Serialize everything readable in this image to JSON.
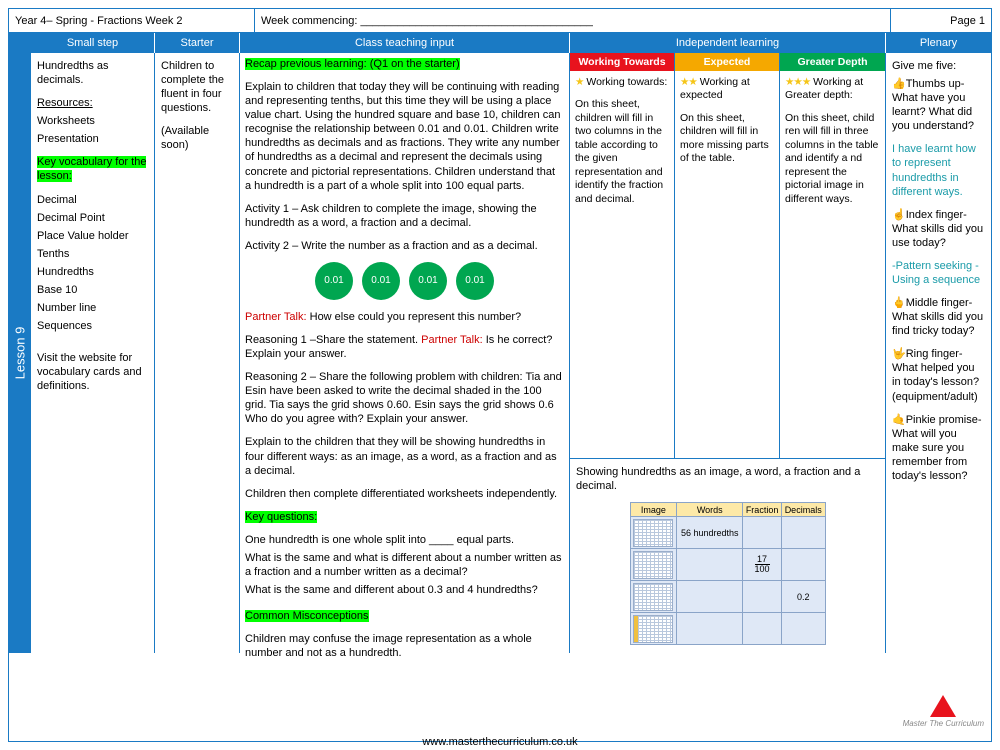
{
  "header": {
    "left": "Year 4– Spring - Fractions Week 2",
    "middle": "Week commencing: ______________________________________",
    "right": "Page 1"
  },
  "columns": {
    "spine": "Lesson 9",
    "small_step": "Small step",
    "starter": "Starter",
    "class_input": "Class teaching input",
    "independent": "Independent learning",
    "plenary": "Plenary"
  },
  "small_step": {
    "title": "Hundredths as decimals.",
    "resources_heading": "Resources:",
    "resources": [
      "Worksheets",
      "Presentation"
    ],
    "vocab_heading": "Key vocabulary for the lesson:",
    "vocab": [
      "Decimal",
      "Decimal Point",
      "Place Value holder",
      "Tenths",
      "Hundredths",
      "Base 10",
      "Number line",
      "Sequences"
    ],
    "footer_note": "Visit the website for vocabulary cards and definitions."
  },
  "starter": {
    "text": "Children to complete the fluent in four questions.",
    "availability": "(Available soon)"
  },
  "class_input": {
    "recap_heading": "Recap previous learning: (Q1 on the starter)",
    "paragraphs": [
      "Explain to children that today they will be continuing with reading and representing tenths, but this time they will be using a place value chart. Using the hundred square and base 10, children can recognise the relationship between 0.01 and 0.01. Children write hundredths as decimals and as fractions. They write any number of hundredths as a decimal and represent the decimals using concrete and pictorial representations. Children understand that a hundredth is a part of a whole split into 100 equal parts.",
      "Activity 1 – Ask children to complete the image, showing the hundredth as a  word, a fraction and a decimal.",
      "Activity 2 – Write the number as a fraction and as a decimal."
    ],
    "circles": [
      "0.01",
      "0.01",
      "0.01",
      "0.01"
    ],
    "partner_talk_1_label": "Partner Talk:",
    "partner_talk_1_text": " How else could you represent this number?",
    "reasoning_1_pre": "Reasoning 1 –Share the statement. ",
    "reasoning_1_label": "Partner Talk:",
    "reasoning_1_post": " Is he correct? Explain your answer.",
    "reasoning_2": "Reasoning 2 –  Share the following problem with children: Tia and Esin have been asked to write the decimal shaded in the 100 grid. Tia says the grid shows 0.60. Esin says the grid shows 0.6 Who do you agree with? Explain your answer.",
    "four_ways": "Explain to the children that they will be showing hundredths in four different ways: as an image, as a word, as a fraction and as a decimal.",
    "independent_work": "Children then complete differentiated worksheets independently.",
    "key_questions_heading": "Key questions:",
    "key_questions": [
      "One hundredth is one whole split into ____ equal parts.",
      "What is the same and what is different about a number written as a fraction and a number written as a decimal?",
      "What is the same and different about 0.3 and 4 hundredths?"
    ],
    "misconceptions_heading": "Common Misconceptions",
    "misconceptions_text": "Children may confuse the image representation as a whole number and not as a hundredth."
  },
  "independent": {
    "levels": [
      {
        "title": "Working Towards",
        "color": "#e8131d",
        "stars": "★",
        "sub": "Working towards:",
        "body": "On this sheet, children will fill in two columns in the table according to the given representation and identify the fraction and decimal."
      },
      {
        "title": "Expected",
        "color": "#f5a800",
        "stars": "★★",
        "sub": "Working at expected",
        "body": "On this sheet, children will fill in more missing parts of the table."
      },
      {
        "title": "Greater Depth",
        "color": "#00a650",
        "stars": "★★★",
        "sub": "Working at Greater depth:",
        "body": "On this sheet, child ren will fill in three columns in the table and identify a nd represent the pictorial image in different ways."
      }
    ],
    "bottom_caption": "Showing hundredths as an image, a word, a fraction and a decimal.",
    "table": {
      "headers": [
        "Image",
        "Words",
        "Fraction",
        "Decimals"
      ],
      "rows": [
        {
          "image": "grid",
          "words": "56 hundredths",
          "fraction": "",
          "decimals": ""
        },
        {
          "image": "grid",
          "words": "",
          "fraction": "17/100",
          "decimals": ""
        },
        {
          "image": "grid",
          "words": "",
          "fraction": "",
          "decimals": "0.2"
        },
        {
          "image": "grid-part",
          "words": "",
          "fraction": "",
          "decimals": ""
        }
      ]
    }
  },
  "plenary": {
    "heading": "Give me five:",
    "items": [
      {
        "icon": "thumbs-up",
        "text": "Thumbs up- What have you learnt? What did you understand?"
      },
      {
        "icon": "none",
        "text": "I have learnt how to represent hundredths in different ways.",
        "style": "teal"
      },
      {
        "icon": "index-finger",
        "text": "Index finger- What skills did you use today?"
      },
      {
        "icon": "none",
        "text": "-Pattern seeking - Using a sequence",
        "style": "teal"
      },
      {
        "icon": "middle-finger",
        "text": "Middle finger- What skills did you find tricky today?"
      },
      {
        "icon": "ring-finger",
        "text": "Ring finger- What helped you in today's lesson? (equipment/adult)"
      },
      {
        "icon": "pinkie",
        "text": "Pinkie promise- What will you make sure you remember from today's lesson?"
      }
    ]
  },
  "footer": {
    "url": "www.masterthecurriculum.co.uk",
    "brand": "Master The Curriculum"
  }
}
